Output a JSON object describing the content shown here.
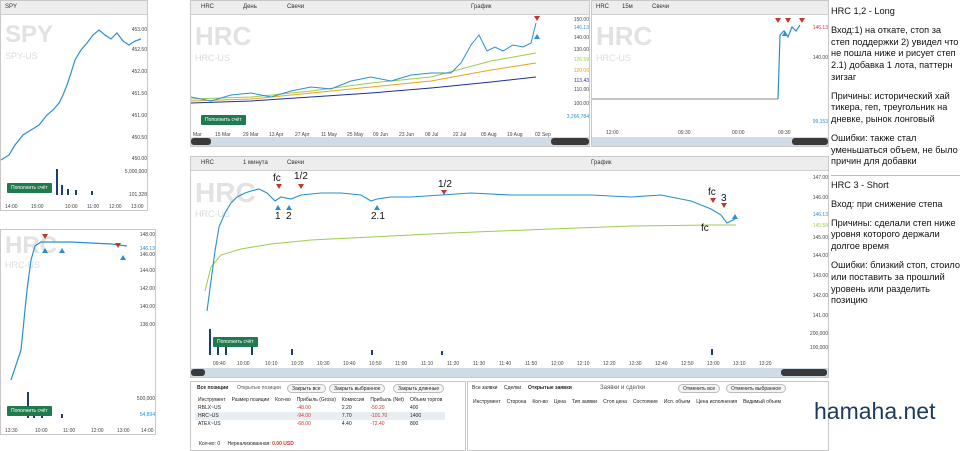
{
  "spy_win": {
    "watermark": "SPY",
    "sub": "SPY-US",
    "y_ticks": [
      "453.00",
      "452.50",
      "452.00",
      "451.50",
      "451.00",
      "450.50",
      "450.00"
    ],
    "vol_ticks": [
      "5,000,000",
      "101,328"
    ],
    "x_ticks": [
      "14:00",
      "15:00",
      "10:00",
      "11:00",
      "12:00",
      "13:00"
    ],
    "fill_btn": "Пополнить счёт"
  },
  "hrc_day": {
    "toolbar": {
      "ticker": "HRC",
      "interval": "День",
      "type": "Свечи",
      "chart": "График"
    },
    "watermark": "HRC",
    "sub": "HRC-US",
    "y_ticks": [
      "150.00",
      "146.13",
      "140.00",
      "130.00",
      "126.59",
      "120.06",
      "113.43",
      "110.00",
      "100.00"
    ],
    "vol_tick": "3,266,784",
    "x_ticks": [
      "Mar",
      "15 Mar",
      "29 Mar",
      "13 Apr",
      "27 Apr",
      "11 May",
      "25 May",
      "09 Jun",
      "23 Jun",
      "08 Jul",
      "22 Jul",
      "05 Aug",
      "19 Aug",
      "02 Sep"
    ],
    "fill_btn": "Пополнить счёт"
  },
  "hrc_15": {
    "toolbar": {
      "ticker": "HRC",
      "interval": "15м",
      "type": "Свечи"
    },
    "watermark": "HRC",
    "sub": "HRC-US",
    "y_ticks": [
      "146.13",
      "140.00"
    ],
    "vol_tick": "99,153",
    "x_ticks": [
      "12:00",
      "09:30",
      "00:00",
      "09:30"
    ]
  },
  "hrc_bl": {
    "watermark": "HRC",
    "sub": "HRC-US",
    "y_ticks": [
      "148.00",
      "146.13",
      "146.00",
      "144.00",
      "142.00",
      "140.00",
      "138.00"
    ],
    "vol_ticks": [
      "500,000",
      "54,894"
    ],
    "x_ticks": [
      "13:30",
      "10:00",
      "11:00",
      "12:00",
      "13:00",
      "14:00"
    ],
    "fill_btn": "Пополнить счёт"
  },
  "hrc_1m": {
    "toolbar": {
      "ticker": "HRC",
      "interval": "1 минута",
      "type": "Свечи",
      "chart": "График"
    },
    "watermark": "HRC",
    "sub": "HRC-US",
    "y_ticks": [
      "147.00",
      "146.00",
      "146.13",
      "145.58",
      "145.00",
      "144.00",
      "143.00",
      "142.00",
      "141.00"
    ],
    "vol_ticks": [
      "200,000",
      "100,000"
    ],
    "x_ticks": [
      "09:40",
      "10:00",
      "10:10",
      "10:20",
      "10:30",
      "10:40",
      "10:50",
      "11:00",
      "11:10",
      "11:20",
      "11:30",
      "11:40",
      "11:50",
      "12:00",
      "12:10",
      "12:20",
      "12:30",
      "12:40",
      "12:50",
      "13:00",
      "13:10",
      "13:20"
    ],
    "fill_btn": "Пополнить счёт",
    "marks": {
      "fc1": "fc",
      "half1": "1/2",
      "n1": "1",
      "n2": "2",
      "n21": "2.1",
      "half2": "1/2",
      "fc2": "fc",
      "n3": "3",
      "fc3": "fc"
    }
  },
  "positions": {
    "tabs": [
      "Все позиции",
      "Открытые позиции"
    ],
    "buttons": [
      "Закрыть все",
      "Закрыть выбранное",
      "Закрыть длинные"
    ],
    "headers": [
      "Инструмент",
      "Размер позиции",
      "Кол-во",
      "Прибыль (Gross)",
      "Комиссия",
      "Прибыль (Net)",
      "Объем торгов"
    ],
    "rows": [
      [
        "RBLX~US",
        "",
        "",
        "-48.00",
        "2.20",
        "-50.20",
        "400"
      ],
      [
        "HRC~US",
        "",
        "",
        "-94.00",
        "7.70",
        "-101.70",
        "1400"
      ],
      [
        "ATEX~US",
        "",
        "",
        "-68.00",
        "4.40",
        "-72.40",
        "800"
      ]
    ],
    "footer": {
      "count_label": "Кол-во:",
      "count": "0",
      "unreal_label": "Нереализованная:",
      "unreal": "0.00 USD"
    }
  },
  "orders": {
    "tabs": [
      "Все заявки",
      "Сделки",
      "Открытые заявки"
    ],
    "title": "Заявки и сделки",
    "buttons": [
      "Отменить все",
      "Отменить выбранное"
    ],
    "headers": [
      "Инструмент",
      "Сторона",
      "Кол-во",
      "Цена",
      "Тип заявки",
      "Стоп цена",
      "Состояние",
      "Исп. объем",
      "Цена исполнения",
      "Видимый объем"
    ]
  },
  "notes": {
    "p1": "HRC 1,2 - Long",
    "p2": "Вход:1) на откате, стоп за степ поддержки 2) увидел что не пошла ниже и рисует степ 2.1) добавка 1 лота, паттерн зигзаг",
    "p3": "Причины: исторический хай тикера, геп, треугольник на дневке, рынок лонговый",
    "p4": "Ошибки: также стал уменьшаться объем, не было причин для добавки",
    "p5": "HRC 3 - Short",
    "p6": "Вход: при снижение степа",
    "p7": "Причины: сделали степ ниже уровня которого держали долгое время",
    "p8": "Ошибки: близкий стоп, стоило или поставить за прошлий уровень или разделить позицию",
    "brand": "hamaha.net"
  },
  "colors": {
    "up": "#2a8fd1",
    "down": "#c0392b",
    "green": "#1f7a4d",
    "ema1": "#9ccc4f",
    "ema2": "#e3a51e",
    "ema3": "#1d2f9c"
  }
}
